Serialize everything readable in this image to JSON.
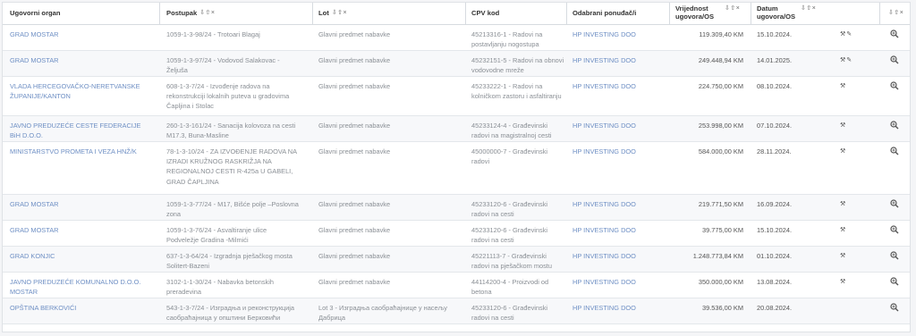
{
  "columns": [
    {
      "label": "Ugovorni organ",
      "tools": ""
    },
    {
      "label": "Postupak",
      "tools": "⇩⇧×"
    },
    {
      "label": "Lot",
      "tools": "⇩⇧×"
    },
    {
      "label": "CPV kod",
      "tools": ""
    },
    {
      "label": "Odabrani ponuđač/i",
      "tools": ""
    },
    {
      "label": "Vrijednost ugovora/OS",
      "tools": "⇩⇧×"
    },
    {
      "label": "Datum ugovora/OS",
      "tools": "⇩⇧×"
    },
    {
      "label": "",
      "tools": "⇩⇧×"
    }
  ],
  "rows": [
    {
      "organ": "GRAD MOSTAR",
      "postupak": "1059-1-3-98/24 - Trotoari Blagaj",
      "lot": "Glavni predmet nabavke",
      "cpv": "45213316-1 - Radovi na postavljanju nogostupa",
      "ponudac": "HP INVESTING DOO",
      "vrijednost": "119.309,40 KM",
      "datum": "15.10.2024.",
      "icons": [
        "wrench-icon",
        "pencil-icon"
      ]
    },
    {
      "organ": "GRAD MOSTAR",
      "postupak": "1059-1-3-97/24 - Vodovod Salakovac - Željuša",
      "lot": "Glavni predmet nabavke",
      "cpv": "45232151-5 - Radovi na obnovi vodovodne mreže",
      "ponudac": "HP INVESTING DOO",
      "vrijednost": "249.448,94 KM",
      "datum": "14.01.2025.",
      "icons": [
        "wrench-icon",
        "pencil-icon"
      ]
    },
    {
      "organ": "VLADA HERCEGOVAČKO-NERETVANSKE ŽUPANIJE/KANTON",
      "postupak": "608-1-3-7/24 - Izvođenje radova na rekonstrukciji lokalnih puteva u gradovima Čapljina i Stolac",
      "lot": "Glavni predmet nabavke",
      "cpv": "45233222-1 - Radovi na kolničkom zastoru i asfaltiranju",
      "ponudac": "HP INVESTING DOO",
      "vrijednost": "224.750,00 KM",
      "datum": "08.10.2024.",
      "icons": [
        "wrench-icon"
      ]
    },
    {
      "organ": "JAVNO PREDUZEĆE CESTE FEDERACIJE BiH D.O.O.",
      "postupak": "260-1-3-161/24 - Sanacija kolovoza na cesti M17.3, Buna-Masline",
      "lot": "Glavni predmet nabavke",
      "cpv": "45233124-4 - Građevinski radovi na magistralnoj cesti",
      "ponudac": "HP INVESTING DOO",
      "vrijednost": "253.998,00 KM",
      "datum": "07.10.2024.",
      "icons": [
        "wrench-icon"
      ]
    },
    {
      "organ": "MINISTARSTVO PROMETA I VEZA HNŽ/K",
      "postupak": "78-1-3-10/24 - ZA IZVOĐENJE RADOVA NA IZRADI KRUŽNOG RASKRIŽJA NA REGIONALNOJ CESTI R-425a U GABELI, GRAD ČAPLJINA",
      "lot": "Glavni predmet nabavke",
      "cpv": "45000000-7 - Građevinski radovi",
      "ponudac": "HP INVESTING DOO",
      "vrijednost": "584.000,00 KM",
      "datum": "28.11.2024.",
      "icons": [
        "wrench-icon"
      ]
    },
    {
      "organ": "GRAD MOSTAR",
      "postupak": "1059-1-3-77/24 - M17, Bišće polje –Poslovna zona",
      "lot": "Glavni predmet nabavke",
      "cpv": "45233120-6 - Građevinski radovi na cesti",
      "ponudac": "HP INVESTING DOO",
      "vrijednost": "219.771,50 KM",
      "datum": "16.09.2024.",
      "icons": [
        "wrench-icon"
      ]
    },
    {
      "organ": "GRAD MOSTAR",
      "postupak": "1059-1-3-76/24 - Asvaltiranje ulice Podveležje Gradina -Milmići",
      "lot": "Glavni predmet nabavke",
      "cpv": "45233120-6 - Građevinski radovi na cesti",
      "ponudac": "HP INVESTING DOO",
      "vrijednost": "39.775,00 KM",
      "datum": "15.10.2024.",
      "icons": [
        "wrench-icon"
      ]
    },
    {
      "organ": "GRAD KONJIC",
      "postupak": "637-1-3-64/24 - Izgradnja pješačkog mosta Solitert-Bazeni",
      "lot": "Glavni predmet nabavke",
      "cpv": "45221113-7 - Građevinski radovi na pješačkom mostu",
      "ponudac": "HP INVESTING DOO",
      "vrijednost": "1.248.773,84 KM",
      "datum": "01.10.2024.",
      "icons": [
        "wrench-icon"
      ]
    },
    {
      "organ": "JAVNO PREDUZEĆE KOMUNALNO D.O.O. MOSTAR",
      "postupak": "3102-1-1-30/24 - Nabavka betonskih preradevina",
      "lot": "Glavni predmet nabavke",
      "cpv": "44114200-4 - Proizvodi od betona",
      "ponudac": "HP INVESTING DOO",
      "vrijednost": "350.000,00 KM",
      "datum": "13.08.2024.",
      "icons": [
        "wrench-icon"
      ]
    },
    {
      "organ": "OPŠTINA BERKOVIĆI",
      "postupak": "543-1-3-7/24 - Изградња и реконструкција саобраћајница у општини Берковићи",
      "lot": "Lot 3 - Изградња саобраћајнице у насељу Дабрица",
      "cpv": "45233120-6 - Građevinski radovi na cesti",
      "ponudac": "HP INVESTING DOO",
      "vrijednost": "39.536,00 KM",
      "datum": "20.08.2024.",
      "icons": []
    }
  ]
}
